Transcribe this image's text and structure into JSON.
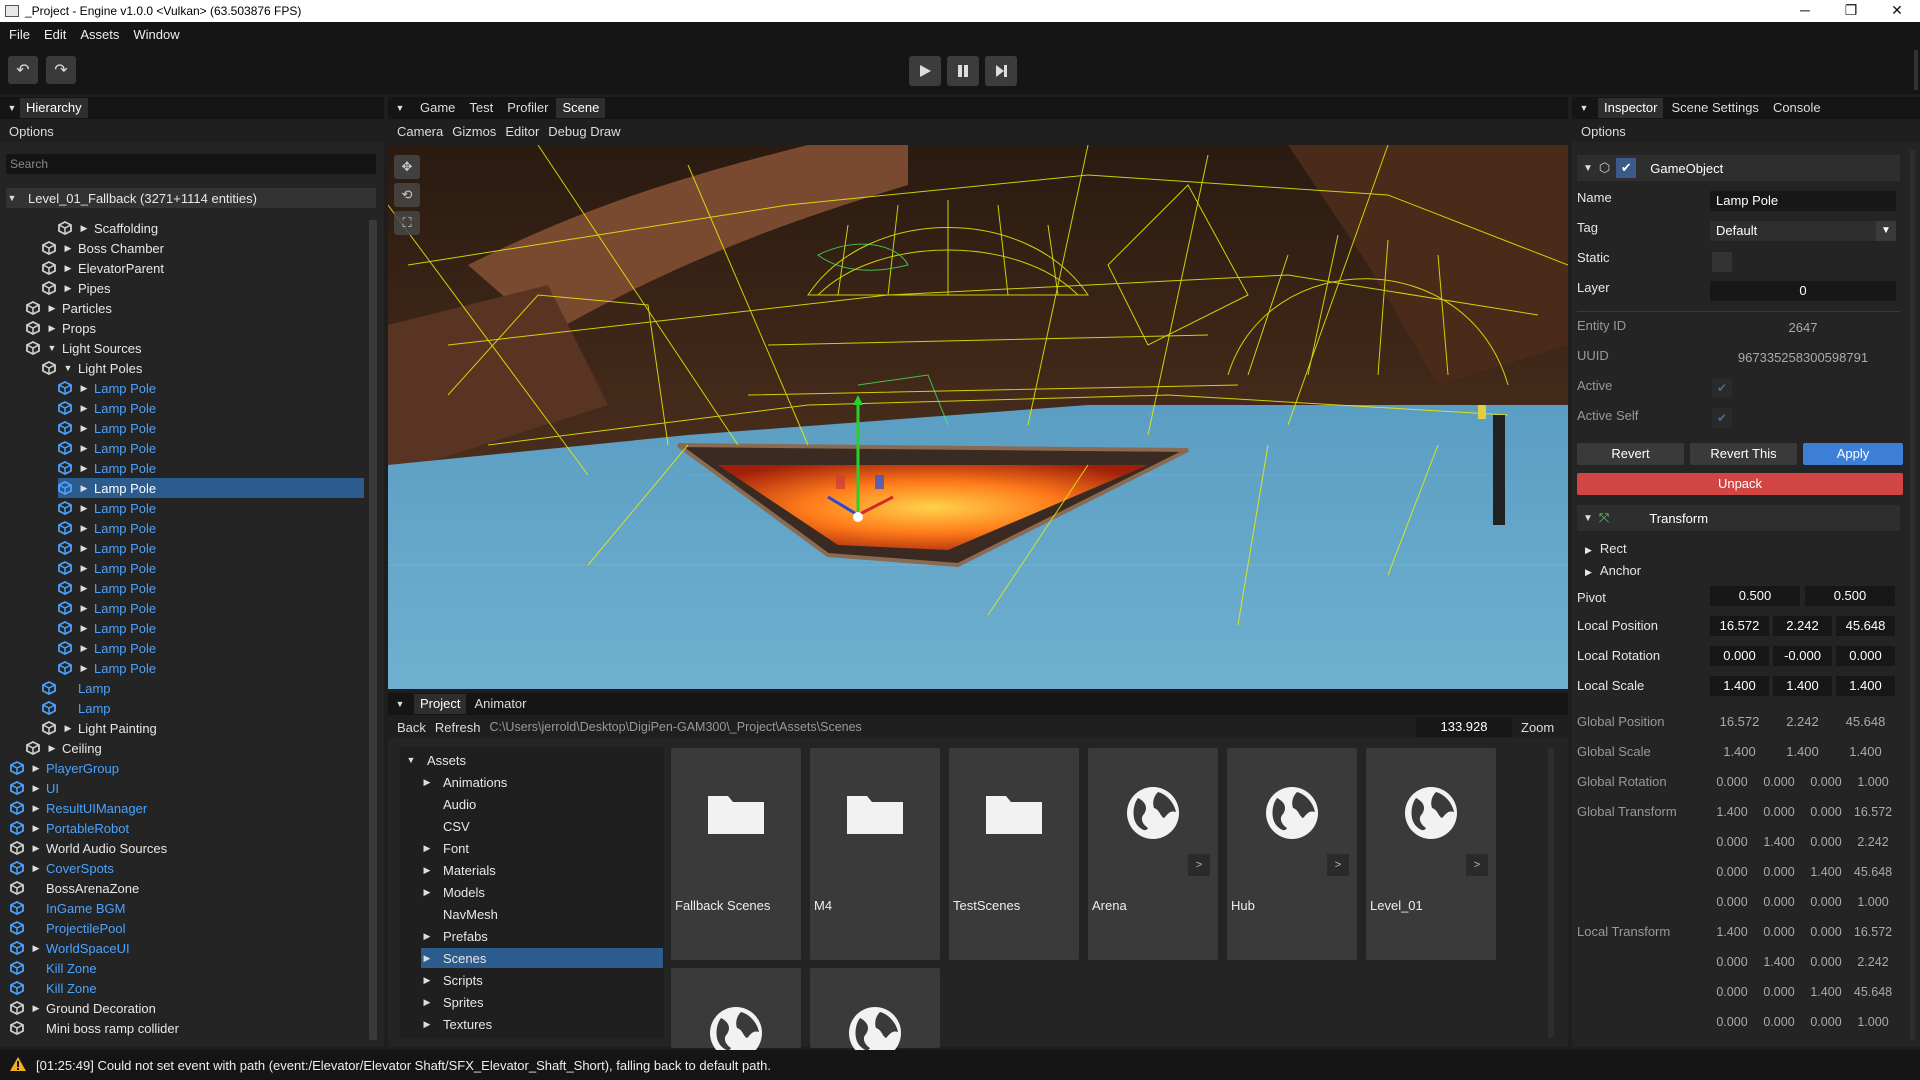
{
  "window": {
    "title": "_Project - Engine v1.0.0 <Vulkan> (63.503876 FPS)",
    "minimize": "─",
    "maximize": "❐",
    "close": "✕"
  },
  "menu": [
    "File",
    "Edit",
    "Assets",
    "Window"
  ],
  "toolbar": {
    "undo": "↶",
    "redo": "↷"
  },
  "hierarchy": {
    "tab": "Hierarchy",
    "options": "Options",
    "search_placeholder": "Search",
    "root": "Level_01_Fallback (3271+1114 entities)",
    "rows": [
      {
        "label": "Scaffolding",
        "depth": 3,
        "expander": "▶",
        "color": "white",
        "icon": "white"
      },
      {
        "label": "Boss Chamber",
        "depth": 2,
        "expander": "▶",
        "color": "white",
        "icon": "white"
      },
      {
        "label": "ElevatorParent",
        "depth": 2,
        "expander": "▶",
        "color": "white",
        "icon": "white"
      },
      {
        "label": "Pipes",
        "depth": 2,
        "expander": "▶",
        "color": "white",
        "icon": "white"
      },
      {
        "label": "Particles",
        "depth": 1,
        "expander": "▶",
        "color": "white",
        "icon": "white"
      },
      {
        "label": "Props",
        "depth": 1,
        "expander": "▶",
        "color": "white",
        "icon": "white"
      },
      {
        "label": "Light Sources",
        "depth": 1,
        "expander": "▼",
        "color": "white",
        "icon": "white"
      },
      {
        "label": "Light Poles",
        "depth": 2,
        "expander": "▼",
        "color": "white",
        "icon": "white"
      },
      {
        "label": "Lamp Pole",
        "depth": 3,
        "expander": "▶",
        "color": "blue",
        "icon": "blue"
      },
      {
        "label": "Lamp Pole",
        "depth": 3,
        "expander": "▶",
        "color": "blue",
        "icon": "blue"
      },
      {
        "label": "Lamp Pole",
        "depth": 3,
        "expander": "▶",
        "color": "blue",
        "icon": "blue"
      },
      {
        "label": "Lamp Pole",
        "depth": 3,
        "expander": "▶",
        "color": "blue",
        "icon": "blue"
      },
      {
        "label": "Lamp Pole",
        "depth": 3,
        "expander": "▶",
        "color": "blue",
        "icon": "blue"
      },
      {
        "label": "Lamp Pole",
        "depth": 3,
        "expander": "▶",
        "color": "blue",
        "icon": "blue",
        "selected": true
      },
      {
        "label": "Lamp Pole",
        "depth": 3,
        "expander": "▶",
        "color": "blue",
        "icon": "blue"
      },
      {
        "label": "Lamp Pole",
        "depth": 3,
        "expander": "▶",
        "color": "blue",
        "icon": "blue"
      },
      {
        "label": "Lamp Pole",
        "depth": 3,
        "expander": "▶",
        "color": "blue",
        "icon": "blue"
      },
      {
        "label": "Lamp Pole",
        "depth": 3,
        "expander": "▶",
        "color": "blue",
        "icon": "blue"
      },
      {
        "label": "Lamp Pole",
        "depth": 3,
        "expander": "▶",
        "color": "blue",
        "icon": "blue"
      },
      {
        "label": "Lamp Pole",
        "depth": 3,
        "expander": "▶",
        "color": "blue",
        "icon": "blue"
      },
      {
        "label": "Lamp Pole",
        "depth": 3,
        "expander": "▶",
        "color": "blue",
        "icon": "blue"
      },
      {
        "label": "Lamp Pole",
        "depth": 3,
        "expander": "▶",
        "color": "blue",
        "icon": "blue"
      },
      {
        "label": "Lamp Pole",
        "depth": 3,
        "expander": "▶",
        "color": "blue",
        "icon": "blue"
      },
      {
        "label": "Lamp",
        "depth": 2,
        "expander": "",
        "color": "blue",
        "icon": "blue"
      },
      {
        "label": "Lamp",
        "depth": 2,
        "expander": "",
        "color": "blue",
        "icon": "blue"
      },
      {
        "label": "Light Painting",
        "depth": 2,
        "expander": "▶",
        "color": "white",
        "icon": "white"
      },
      {
        "label": "Ceiling",
        "depth": 1,
        "expander": "▶",
        "color": "white",
        "icon": "white"
      },
      {
        "label": "PlayerGroup",
        "depth": 0,
        "expander": "▶",
        "color": "blue",
        "icon": "blue"
      },
      {
        "label": "UI",
        "depth": 0,
        "expander": "▶",
        "color": "blue",
        "icon": "blue"
      },
      {
        "label": "ResultUIManager",
        "depth": 0,
        "expander": "▶",
        "color": "blue",
        "icon": "blue"
      },
      {
        "label": "PortableRobot",
        "depth": 0,
        "expander": "▶",
        "color": "blue",
        "icon": "blue"
      },
      {
        "label": "World Audio Sources",
        "depth": 0,
        "expander": "▶",
        "color": "white",
        "icon": "white"
      },
      {
        "label": "CoverSpots",
        "depth": 0,
        "expander": "▶",
        "color": "blue",
        "icon": "blue"
      },
      {
        "label": "BossArenaZone",
        "depth": 0,
        "expander": "",
        "color": "white",
        "icon": "white"
      },
      {
        "label": "InGame BGM",
        "depth": 0,
        "expander": "",
        "color": "blue",
        "icon": "blue"
      },
      {
        "label": "ProjectilePool",
        "depth": 0,
        "expander": "",
        "color": "blue",
        "icon": "blue"
      },
      {
        "label": "WorldSpaceUI",
        "depth": 0,
        "expander": "▶",
        "color": "blue",
        "icon": "blue"
      },
      {
        "label": "Kill Zone",
        "depth": 0,
        "expander": "",
        "color": "blue",
        "icon": "blue"
      },
      {
        "label": "Kill Zone",
        "depth": 0,
        "expander": "",
        "color": "blue",
        "icon": "blue"
      },
      {
        "label": "Ground Decoration",
        "depth": 0,
        "expander": "▶",
        "color": "white",
        "icon": "white"
      },
      {
        "label": "Mini boss ramp collider",
        "depth": 0,
        "expander": "",
        "color": "white",
        "icon": "white"
      }
    ]
  },
  "center": {
    "tabs": [
      "Game",
      "Test",
      "Profiler",
      "Scene"
    ],
    "active_tab": "Scene",
    "submenu": [
      "Camera",
      "Gizmos",
      "Editor",
      "Debug Draw"
    ]
  },
  "project": {
    "tabs": [
      "Project",
      "Animator"
    ],
    "back": "Back",
    "refresh": "Refresh",
    "path": "C:\\Users\\jerrold\\Desktop\\DigiPen-GAM300\\_Project\\Assets\\Scenes",
    "zoom_value": "133.928",
    "zoom_label": "Zoom",
    "tree": [
      {
        "label": "Assets",
        "depth": 0,
        "expander": "▼"
      },
      {
        "label": "Animations",
        "depth": 1,
        "expander": "▶"
      },
      {
        "label": "Audio",
        "depth": 1,
        "expander": ""
      },
      {
        "label": "CSV",
        "depth": 1,
        "expander": ""
      },
      {
        "label": "Font",
        "depth": 1,
        "expander": "▶"
      },
      {
        "label": "Materials",
        "depth": 1,
        "expander": "▶"
      },
      {
        "label": "Models",
        "depth": 1,
        "expander": "▶"
      },
      {
        "label": "NavMesh",
        "depth": 1,
        "expander": ""
      },
      {
        "label": "Prefabs",
        "depth": 1,
        "expander": "▶"
      },
      {
        "label": "Scenes",
        "depth": 1,
        "expander": "▶",
        "selected": true
      },
      {
        "label": "Scripts",
        "depth": 1,
        "expander": "▶"
      },
      {
        "label": "Sprites",
        "depth": 1,
        "expander": "▶"
      },
      {
        "label": "Textures",
        "depth": 1,
        "expander": "▶"
      }
    ],
    "tiles": [
      {
        "name": "Fallback Scenes",
        "icon": "folder-icon",
        "more": ""
      },
      {
        "name": "M4",
        "icon": "folder-icon",
        "more": ""
      },
      {
        "name": "TestScenes",
        "icon": "folder-icon",
        "more": ""
      },
      {
        "name": "Arena",
        "icon": "globe-icon",
        "more": ">"
      },
      {
        "name": "Hub",
        "icon": "globe-icon",
        "more": ">"
      },
      {
        "name": "Level_01",
        "icon": "globe-icon",
        "more": ">"
      },
      {
        "name": "",
        "icon": "globe-icon",
        "more": ""
      },
      {
        "name": "",
        "icon": "globe-icon",
        "more": ""
      }
    ]
  },
  "inspector": {
    "tabs": [
      "Inspector",
      "Scene Settings",
      "Console"
    ],
    "options": "Options",
    "component": "GameObject",
    "name_label": "Name",
    "name_value": "Lamp Pole",
    "tag_label": "Tag",
    "tag_value": "Default",
    "static_label": "Static",
    "layer_label": "Layer",
    "layer_value": "0",
    "entity_label": "Entity ID",
    "entity_value": "2647",
    "uuid_label": "UUID",
    "uuid_value": "9673352583005987​91",
    "active_label": "Active",
    "activeself_label": "Active Self",
    "revert": "Revert",
    "revert_this": "Revert This",
    "apply": "Apply",
    "unpack": "Unpack",
    "transform": "Transform",
    "rect": "Rect",
    "anchor": "Anchor",
    "pivot_label": "Pivot",
    "pivot": [
      "0.500",
      "0.500"
    ],
    "lpos_label": "Local Position",
    "lpos": [
      "16.572",
      "2.242",
      "45.648"
    ],
    "lrot_label": "Local Rotation",
    "lrot": [
      "0.000",
      "-0.000",
      "0.000"
    ],
    "lscale_label": "Local Scale",
    "lscale": [
      "1.400",
      "1.400",
      "1.400"
    ],
    "gpos_label": "Global Position",
    "gpos": [
      "16.572",
      "2.242",
      "45.648"
    ],
    "gscale_label": "Global Scale",
    "gscale": [
      "1.400",
      "1.400",
      "1.400"
    ],
    "grot_label": "Global Rotation",
    "grot": [
      "0.000",
      "0.000",
      "0.000",
      "1.000"
    ],
    "gt_label": "Global Transform",
    "gt": [
      [
        "1.400",
        "0.000",
        "0.000",
        "16.572"
      ],
      [
        "0.000",
        "1.400",
        "0.000",
        "2.242"
      ],
      [
        "0.000",
        "0.000",
        "1.400",
        "45.648"
      ],
      [
        "0.000",
        "0.000",
        "0.000",
        "1.000"
      ]
    ],
    "lt_label": "Local Transform",
    "lt": [
      [
        "1.400",
        "0.000",
        "0.000",
        "16.572"
      ],
      [
        "0.000",
        "1.400",
        "0.000",
        "2.242"
      ],
      [
        "0.000",
        "0.000",
        "1.400",
        "45.648"
      ],
      [
        "0.000",
        "0.000",
        "0.000",
        "1.000"
      ]
    ]
  },
  "status": {
    "message": "[01:25:49] Could not set event with path (event:/Elevator/Elevator Shaft/SFX_Elevator_Shaft_Short), falling back to default path."
  },
  "colors": {
    "accent": "#2c5b8e",
    "apply": "#3d7fd6",
    "unpack": "#d24545",
    "blue_text": "#4aa3ff",
    "lava": "#ff7a1a",
    "wire": "#e8f000",
    "floor": "#5b9ec3"
  }
}
